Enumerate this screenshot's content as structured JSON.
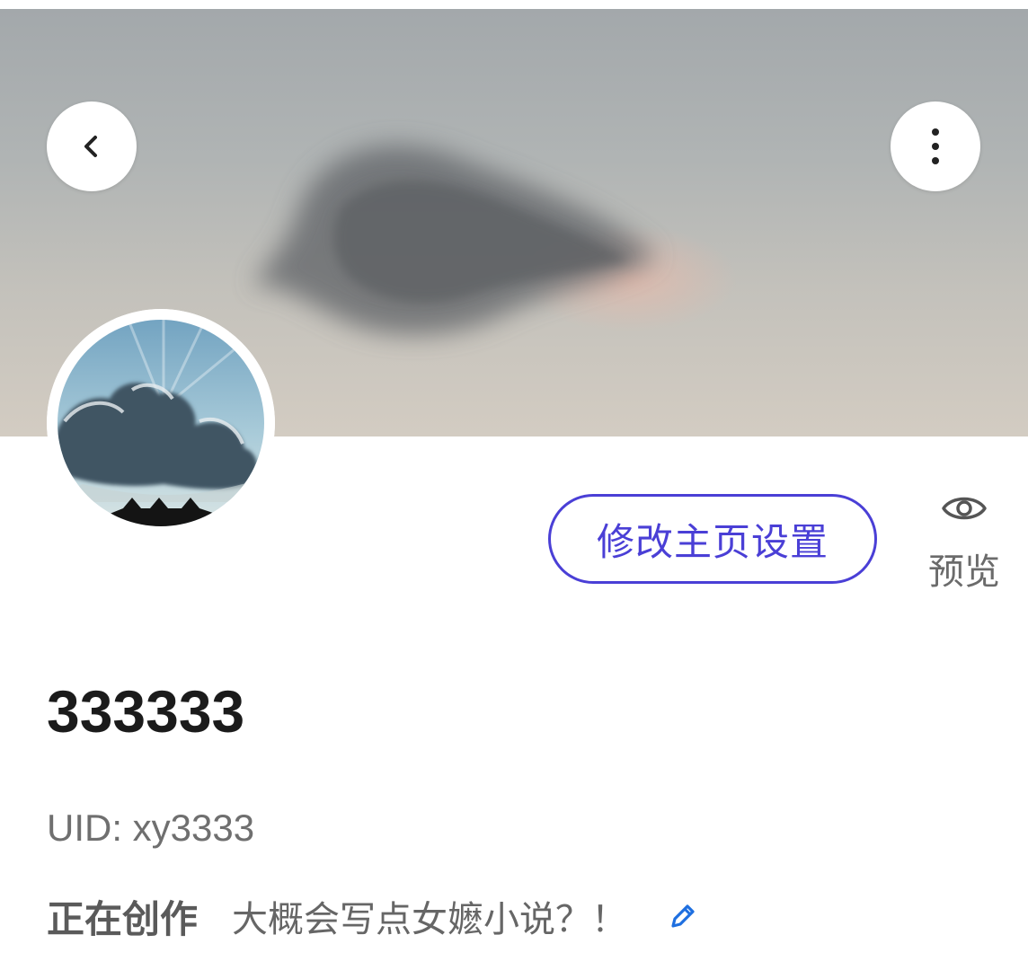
{
  "profile": {
    "nickname": "333333",
    "uid": "UID: xy3333",
    "status_label": "正在创作",
    "status_text": "大概会写点女嬷小说？！"
  },
  "actions": {
    "edit_profile_label": "修改主页设置",
    "preview_label": "预览"
  },
  "icons": {
    "back": "chevron-left-icon",
    "more": "more-vertical-icon",
    "preview": "eye-icon",
    "edit_status": "pencil-icon"
  },
  "colors": {
    "accent": "#4a3fd6",
    "edit_icon": "#1e6fe0",
    "text_primary": "#1b1b1b",
    "text_secondary": "#6f6f6f"
  }
}
